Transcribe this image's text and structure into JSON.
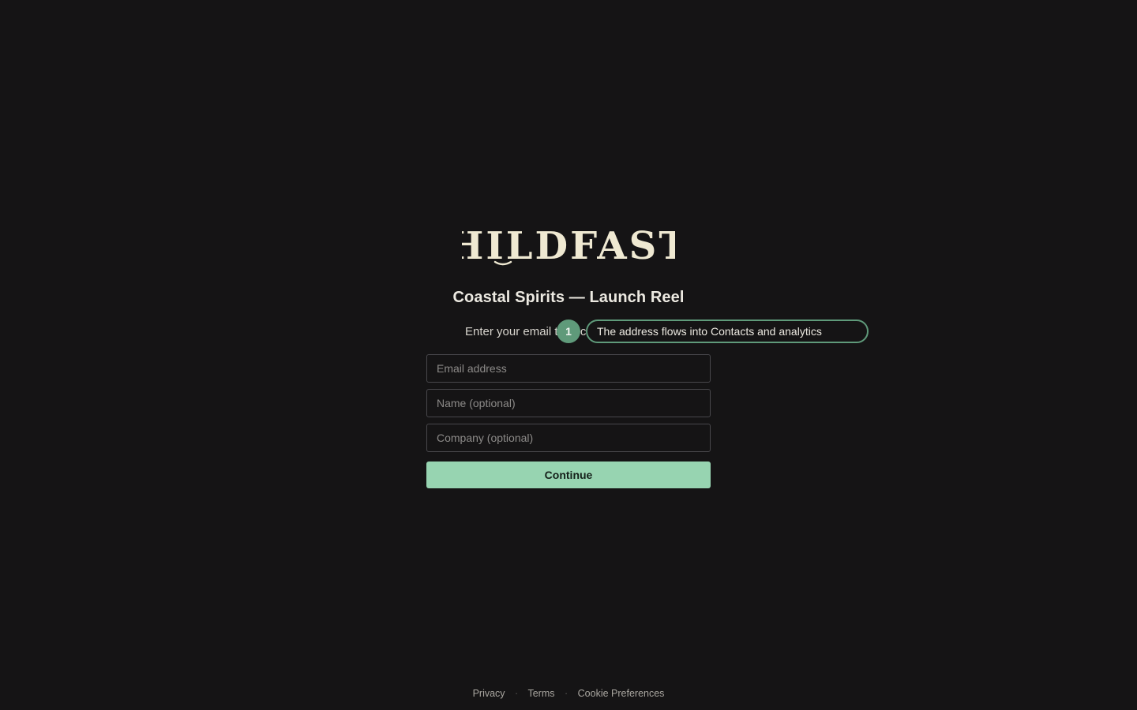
{
  "brand": {
    "logo_text": "HILDFAST"
  },
  "header": {
    "title": "Coastal Spirits — Launch Reel",
    "subtitle": "Enter your email to access"
  },
  "form": {
    "email_placeholder": "Email address",
    "name_placeholder": "Name (optional)",
    "company_placeholder": "Company (optional)",
    "continue_label": "Continue"
  },
  "annotation": {
    "number": "1",
    "text": "The address flows into Contacts and analytics"
  },
  "footer": {
    "privacy": "Privacy",
    "terms": "Terms",
    "cookie": "Cookie Preferences",
    "separator": "·"
  },
  "colors": {
    "background": "#151415",
    "accent": "#97d4b1",
    "annotation": "#5f9a7a",
    "logo": "#efe9d2"
  }
}
